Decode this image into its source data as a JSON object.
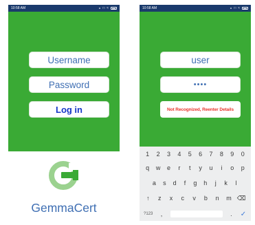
{
  "login_screen": {
    "status_bar": {
      "time": "10:58 AM",
      "icons": [
        "bluetooth-icon",
        "sim-icon",
        "wifi-icon",
        "battery-icon"
      ]
    },
    "username_placeholder": "Username",
    "password_placeholder": "Password",
    "login_label": "Log in",
    "brand": {
      "part1": "Gemma",
      "part2": "Cert"
    }
  },
  "error_screen": {
    "status_bar": {
      "time": "10:58 AM",
      "icons": [
        "bluetooth-icon",
        "sim-icon",
        "wifi-icon",
        "battery-icon"
      ]
    },
    "username_value": "user",
    "password_mask": "••••",
    "error_message": "Not Recognized, Reenter Details",
    "keyboard": {
      "numbers": [
        "1",
        "2",
        "3",
        "4",
        "5",
        "6",
        "7",
        "8",
        "9",
        "0"
      ],
      "row1": [
        "q",
        "w",
        "e",
        "r",
        "t",
        "y",
        "u",
        "i",
        "o",
        "p"
      ],
      "row2": [
        "a",
        "s",
        "d",
        "f",
        "g",
        "h",
        "j",
        "k",
        "l"
      ],
      "row3": [
        "↑",
        "z",
        "x",
        "c",
        "v",
        "b",
        "n",
        "m",
        "⌫"
      ],
      "mode_key": "?123",
      "comma_key": ",",
      "period_key": ".",
      "enter_key": "✓"
    }
  },
  "colors": {
    "green": "#3aaa35",
    "status_bar": "#1a3a6c",
    "field_text": "#3f6fb3",
    "login_text": "#1536c7",
    "error_text": "#e8322a"
  }
}
